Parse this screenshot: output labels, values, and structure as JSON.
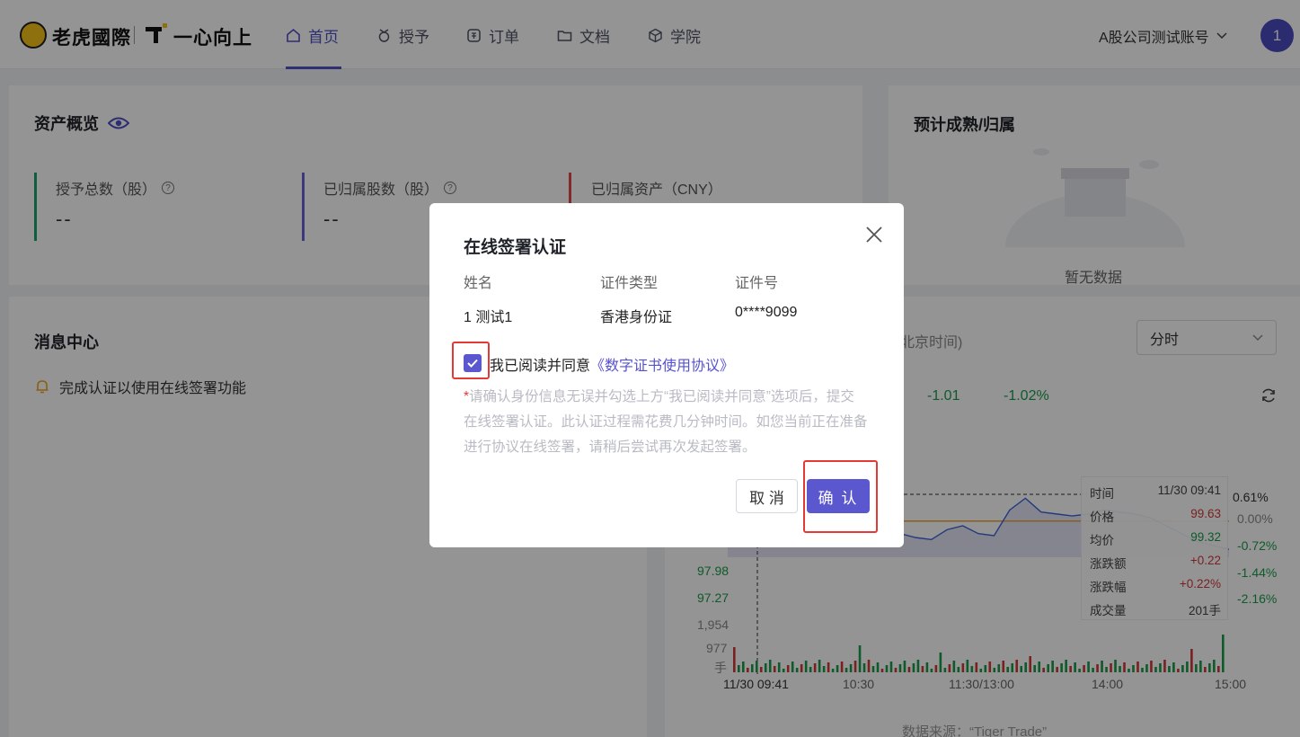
{
  "header": {
    "brand1": "老虎國際",
    "brand2": "一心向上",
    "nav": [
      {
        "label": "首页",
        "active": true
      },
      {
        "label": "授予",
        "active": false
      },
      {
        "label": "订单",
        "active": false
      },
      {
        "label": "文档",
        "active": false
      },
      {
        "label": "学院",
        "active": false
      }
    ],
    "account": "A股公司测试账号",
    "avatar": "1"
  },
  "assets": {
    "title": "资产概览",
    "stats": [
      {
        "label": "授予总数（股）",
        "value": "--",
        "color": "#1aa36b"
      },
      {
        "label": "已归属股数（股）",
        "value": "--",
        "color": "#6b62d6"
      },
      {
        "label": "已归属资产（CNY）",
        "value": "",
        "color": "#e0474c"
      }
    ]
  },
  "vesting": {
    "title": "预计成熟/归属",
    "empty": "暂无数据"
  },
  "messages": {
    "title": "消息中心",
    "items": [
      "完成认证以使用在线签署功能"
    ]
  },
  "quote": {
    "time_zone_label": "北京时间)",
    "period_select": "分时",
    "change": "-1.01",
    "change_pct": "-1.02%",
    "source": "数据来源：“Tiger Trade”"
  },
  "chart_data": {
    "type": "line",
    "y_left_labels": [
      "97.98",
      "97.27"
    ],
    "y_right_labels": [
      "0.61%",
      "0.00%",
      "-0.72%",
      "-1.44%",
      "-2.16%"
    ],
    "volume_labels": [
      "1,954",
      "977",
      "手"
    ],
    "x_labels": [
      "11/30 09:41",
      "10:30",
      "11:30/13:00",
      "14:00",
      "15:00"
    ],
    "price": [
      99.2,
      99.15,
      98.9,
      98.95,
      99.0,
      98.85,
      98.8,
      99.0,
      98.9,
      98.95,
      99.05,
      99.0,
      98.9,
      98.85,
      99.1,
      99.2,
      99.0,
      98.95,
      99.6,
      99.9,
      99.55,
      99.5,
      99.45,
      99.5,
      99.6,
      99.55,
      99.5,
      99.4,
      99.2,
      99.0,
      98.8,
      98.7,
      98.6
    ],
    "avg_line": 99.32,
    "tooltip": {
      "rows": [
        {
          "label": "时间",
          "value": "11/30 09:41"
        },
        {
          "label": "价格",
          "value": "99.63"
        },
        {
          "label": "均价",
          "value": "99.32"
        },
        {
          "label": "涨跌额",
          "value": "+0.22"
        },
        {
          "label": "涨跌幅",
          "value": "+0.22%"
        },
        {
          "label": "成交量",
          "value": "201手"
        }
      ]
    }
  },
  "dialog": {
    "title": "在线签署认证",
    "columns": [
      "姓名",
      "证件类型",
      "证件号"
    ],
    "row": [
      "1 测试1",
      "香港身份证",
      "0****9099"
    ],
    "agree_text": "我已阅读并同意",
    "agree_link": "《数字证书使用协议》",
    "agreed": true,
    "note_star": "*",
    "note": "请确认身份信息无误并勾选上方“我已阅读并同意”选项后，提交在线签署认证。此认证过程需花费几分钟时间。如您当前正在准备进行协议在线签署，请稍后尝试再次发起签署。",
    "cancel": "取 消",
    "confirm": "确 认"
  }
}
